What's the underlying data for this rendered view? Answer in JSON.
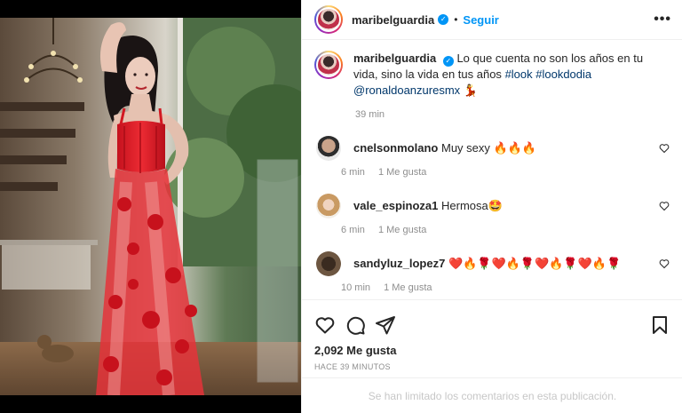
{
  "post": {
    "username": "maribelguardia",
    "follow_label": "Seguir",
    "caption_text": "Lo que cuenta no son los años en tu vida, sino la vida en tus años ",
    "caption_tags": "#look #lookdodia @ronaldoanzuresmx",
    "caption_emoji": "💃",
    "caption_time": "39 min",
    "likes": "2,092 Me gusta",
    "timestamp": "HACE 39 MINUTOS",
    "limited_comments": "Se han limitado los comentarios en esta publicación."
  },
  "comments": [
    {
      "user": "cnelsonmolano",
      "text": "Muy sexy 🔥🔥🔥",
      "time": "6 min",
      "likes": "1 Me gusta"
    },
    {
      "user": "vale_espinoza1",
      "text": "Hermosa🤩",
      "time": "6 min",
      "likes": "1 Me gusta"
    },
    {
      "user": "sandyluz_lopez7",
      "text": "❤️🔥🌹❤️🔥🌹❤️🔥🌹❤️🔥🌹",
      "time": "10 min",
      "likes": "1 Me gusta"
    }
  ],
  "icons": {
    "like": "heart-icon",
    "comment": "comment-icon",
    "share": "send-icon",
    "save": "bookmark-icon",
    "more": "more-options-icon",
    "verified": "verified-badge-icon"
  },
  "colors": {
    "accent": "#0095f6",
    "dress": "#e01b24",
    "link": "#00376b"
  }
}
